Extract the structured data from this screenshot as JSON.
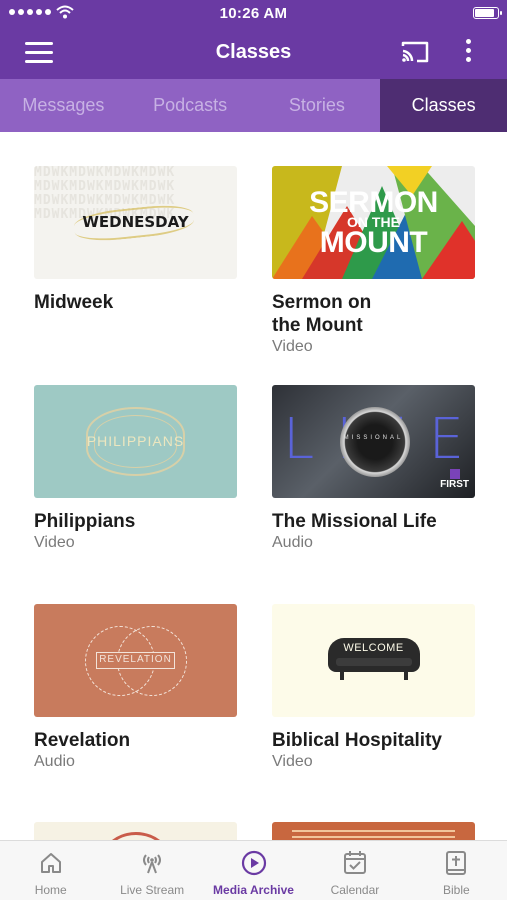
{
  "status_bar": {
    "time": "10:26 AM"
  },
  "header": {
    "title": "Classes"
  },
  "tabs": [
    {
      "label": "Messages",
      "active": false
    },
    {
      "label": "Podcasts",
      "active": false
    },
    {
      "label": "Stories",
      "active": false
    },
    {
      "label": "Classes",
      "active": true
    }
  ],
  "classes": [
    {
      "title": "Midweek",
      "type": "",
      "thumb_text": "WEDNESDAY"
    },
    {
      "title": "Sermon on the Mount",
      "type": "Video",
      "thumb_text": [
        "SERMON",
        "ON THE",
        "MOUNT"
      ]
    },
    {
      "title": "Philippians",
      "type": "Video",
      "thumb_text": "PHILIPPIANS"
    },
    {
      "title": "The Missional Life",
      "type": "Audio",
      "thumb_text": [
        "L",
        "I",
        "F",
        "E"
      ],
      "thumb_subtext": "MISSIONAL",
      "thumb_badge": "FIRST"
    },
    {
      "title": "Revelation",
      "type": "Audio",
      "thumb_text": "REVELATION"
    },
    {
      "title": "Biblical Hospitality",
      "type": "Video",
      "thumb_text": "WELCOME"
    }
  ],
  "bottom_nav": [
    {
      "label": "Home",
      "icon": "home-icon",
      "active": false
    },
    {
      "label": "Live Stream",
      "icon": "broadcast-icon",
      "active": false
    },
    {
      "label": "Media Archive",
      "icon": "play-circle-icon",
      "active": true
    },
    {
      "label": "Calendar",
      "icon": "calendar-icon",
      "active": false
    },
    {
      "label": "Bible",
      "icon": "bible-icon",
      "active": false
    }
  ],
  "colors": {
    "header_bg": "#6a3aa3",
    "tabs_bg": "#8f62c3",
    "tab_active_bg": "#4e2d72",
    "accent": "#6a3aa3"
  }
}
